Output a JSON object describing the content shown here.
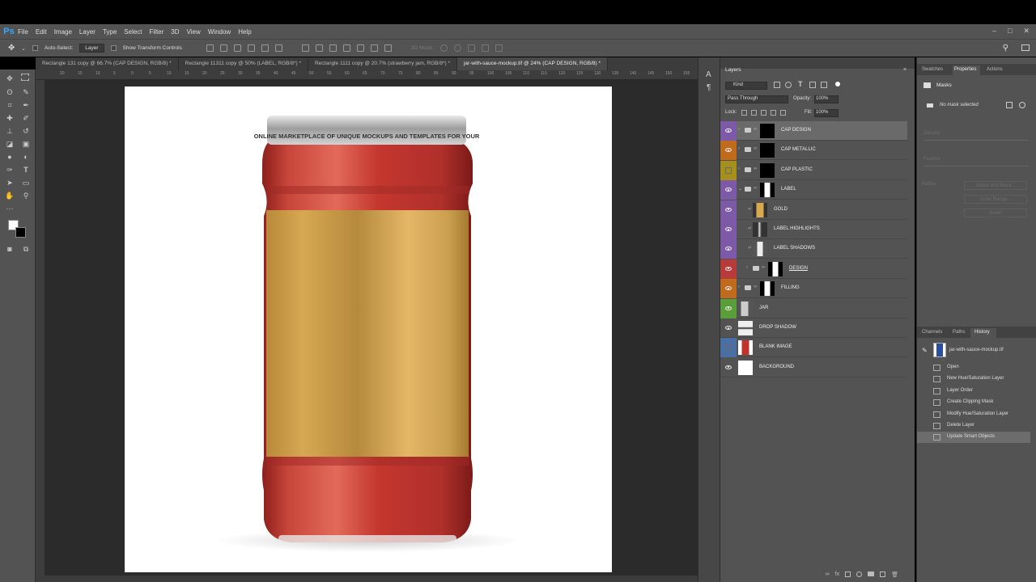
{
  "app": {
    "logo": "Ps"
  },
  "menu": [
    "File",
    "Edit",
    "Image",
    "Layer",
    "Type",
    "Select",
    "Filter",
    "3D",
    "View",
    "Window",
    "Help"
  ],
  "window_controls": [
    "–",
    "□",
    "✕"
  ],
  "options": {
    "auto_select_label": "Auto-Select:",
    "auto_select_value": "Layer",
    "show_transform_label": "Show Transform Controls",
    "mode_3d_label": "3D Mode:"
  },
  "tabs": [
    "Rectangle 131 copy @ 66.7% (CAP DESIGN, RGB/8) *",
    "Rectangle 11311 copy @ 50% (LABEL, RGB/8*) *",
    "Rectangle 1111 copy @ 20.7% (strawberry jam, RGB/8*) *",
    "jar-with-sauce-mockup.tif @ 24% (CAP DESIGN, RGB/8) *"
  ],
  "active_tab_index": 3,
  "ruler": [
    "20",
    "15",
    "10",
    "5",
    "0",
    "5",
    "10",
    "15",
    "20",
    "25",
    "30",
    "35",
    "40",
    "45",
    "50",
    "55",
    "60",
    "65",
    "70",
    "75",
    "80",
    "85",
    "90",
    "95",
    "100",
    "105",
    "110",
    "115",
    "120",
    "125",
    "130",
    "135",
    "140",
    "145",
    "150",
    "155",
    "160"
  ],
  "canvas": {
    "cap_text": "ONLINE MARKETPLACE OF UNIQUE MOCKUPS AND TEMPLATES FOR YOUR",
    "colors": {
      "sauce": "#c0322b",
      "label_gold": "#d9a94f",
      "cap": "#bfbfbf"
    }
  },
  "layers_panel": {
    "title": "Layers",
    "filter_label": "Kind",
    "blend_mode": "Pass Through",
    "opacity_label": "Opacity:",
    "opacity_value": "100%",
    "lock_label": "Lock:",
    "fill_label": "Fill:",
    "fill_value": "100%",
    "layers": [
      {
        "name": "CAP DESIGN",
        "color": "#7d5aa8",
        "type": "group",
        "selected": true
      },
      {
        "name": "CAP METALLIC",
        "color": "#c06a1c",
        "type": "group"
      },
      {
        "name": "CAP PLASTIC",
        "color": "#a6901c",
        "type": "group",
        "hidden": true
      },
      {
        "name": "LABEL",
        "color": "#7d5aa8",
        "type": "group-open"
      },
      {
        "name": "GOLD",
        "color": "#7d5aa8",
        "type": "clip"
      },
      {
        "name": "LABEL HIGHLIGHTS",
        "color": "#7d5aa8",
        "type": "clip"
      },
      {
        "name": "LABEL SHADOWS",
        "color": "#7d5aa8",
        "type": "clip"
      },
      {
        "name": "DESIGN",
        "color": "#b83a3a",
        "type": "smart-group"
      },
      {
        "name": "FILLING",
        "color": "#c06a1c",
        "type": "group"
      },
      {
        "name": "JAR",
        "color": "#5a9e3c",
        "type": "layer"
      },
      {
        "name": "DROP SHADOW",
        "color": "",
        "type": "layer"
      },
      {
        "name": "BLANK IMAGE",
        "color": "#4a6fa5",
        "type": "layer",
        "hidden": true
      },
      {
        "name": "BACKGROUND",
        "color": "",
        "type": "layer"
      }
    ]
  },
  "properties_panel": {
    "tabs": [
      "Swatches",
      "Properties",
      "Actions"
    ],
    "active_tab": "Properties",
    "masks_label": "Masks",
    "no_mask_text": "No mask selected",
    "density_label": "Density:",
    "feather_label": "Feather:",
    "refine_label": "Refine:",
    "buttons": [
      "Select and Mask...",
      "Color Range...",
      "Invert"
    ]
  },
  "history_panel": {
    "tabs": [
      "Channels",
      "Paths",
      "History"
    ],
    "active_tab": "History",
    "snapshot": "jar-with-sauce-mockup.tif",
    "steps": [
      "Open",
      "New Hue/Saturation Layer",
      "Layer Order",
      "Create Clipping Mask",
      "Modify Hue/Saturation Layer",
      "Delete Layer",
      "Update Smart Objects"
    ],
    "selected_step": 6
  }
}
